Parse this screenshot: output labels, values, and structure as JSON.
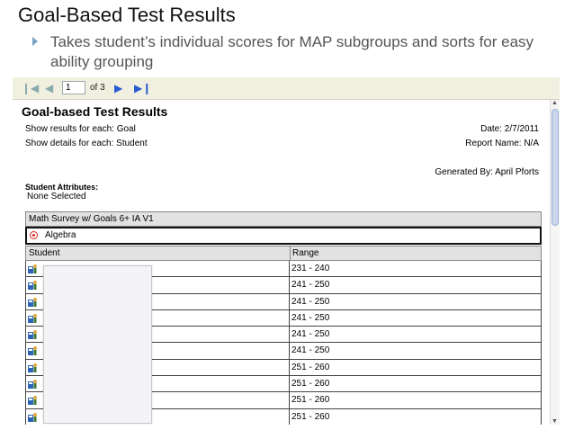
{
  "slide": {
    "title": "Goal-Based Test Results",
    "bullet": "Takes student’s individual scores for MAP subgroups and sorts for easy ability grouping"
  },
  "toolbar": {
    "first_icon": "first-page-icon",
    "prev_icon": "previous-page-icon",
    "page_value": "1",
    "of_label": "of 3",
    "next_icon": "next-page-icon",
    "last_icon": "last-page-icon"
  },
  "report": {
    "title": "Goal-based Test Results",
    "show_results": "Show results for each: Goal",
    "show_details": "Show details for each: Student",
    "date": "Date: 2/7/2011",
    "report_name": "Report Name: N/A",
    "generated_by": "Generated By: April Pforts",
    "attributes_label": "Student Attributes:",
    "attributes_value": "None Selected",
    "group_label": "Math Survey w/ Goals 6+ IA V1",
    "goal_label": "Algebra",
    "table": {
      "headers": [
        "Student",
        "Range"
      ],
      "rows": [
        {
          "range": "231 - 240"
        },
        {
          "range": "241 - 250"
        },
        {
          "range": "241 - 250"
        },
        {
          "range": "241 - 250"
        },
        {
          "range": "241 - 250"
        },
        {
          "range": "241 - 250"
        },
        {
          "range": "251 - 260"
        },
        {
          "range": "251 - 260"
        },
        {
          "range": "251 - 260"
        },
        {
          "range": "251 - 260"
        }
      ]
    }
  },
  "colors": {
    "toolbar_bg": "#f1efe0",
    "header_bg": "#e2e2e2",
    "bullet": "#7aa1c2",
    "nav_blue": "#2a5bd1"
  }
}
